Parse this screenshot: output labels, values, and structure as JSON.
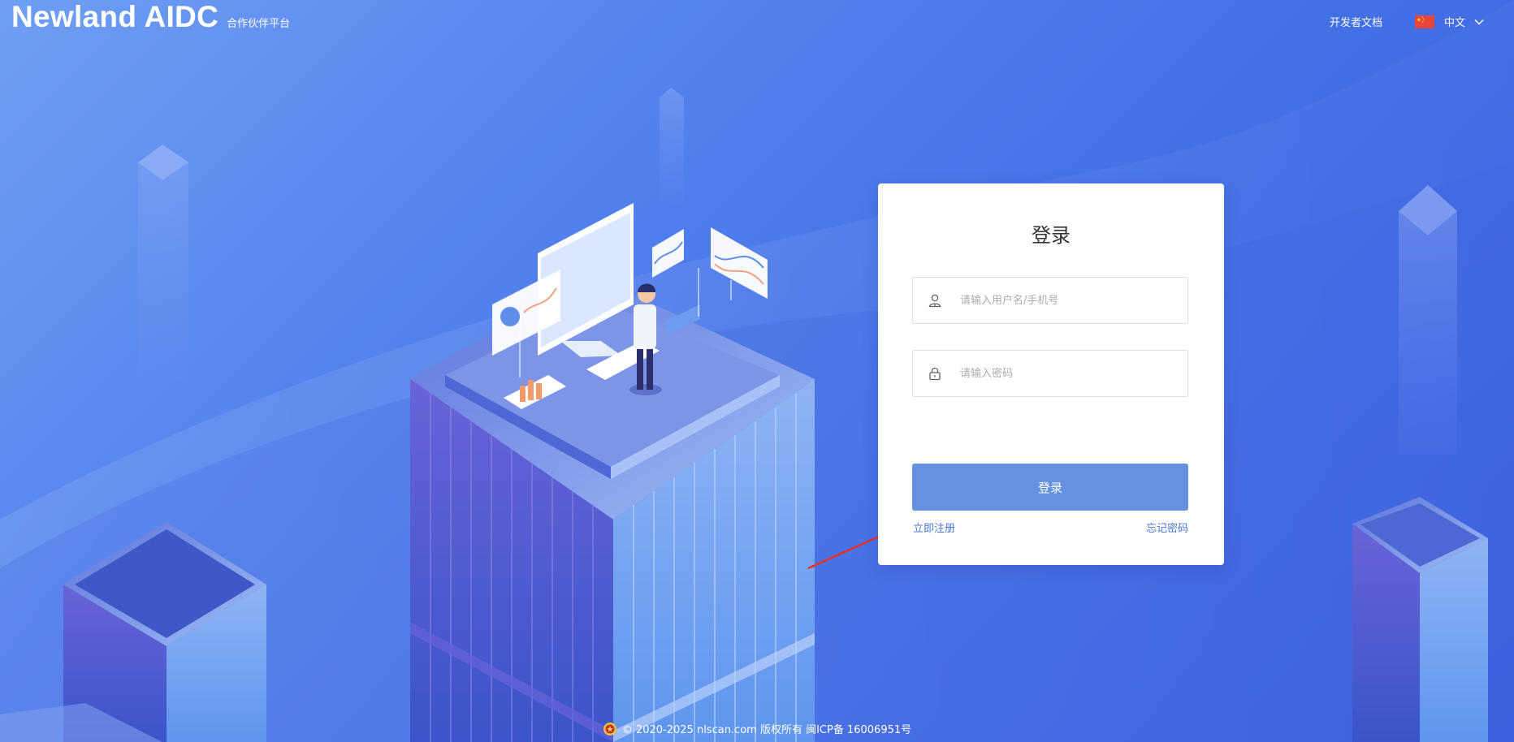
{
  "header": {
    "brand_name": "Newland AIDC",
    "brand_subtitle": "合作伙伴平台",
    "dev_docs_label": "开发者文档",
    "language": {
      "flag_icon": "china-flag-icon",
      "label": "中文",
      "chevron_icon": "chevron-down-icon"
    }
  },
  "login_card": {
    "title": "登录",
    "username_placeholder": "请输入用户名/手机号",
    "username_icon": "user-icon",
    "password_placeholder": "请输入密码",
    "password_icon": "lock-icon",
    "submit_label": "登录",
    "register_link": "立即注册",
    "forgot_link": "忘记密码"
  },
  "footer": {
    "icon": "police-badge-icon",
    "text": "© 2020-2025 nlscan.com 版权所有 闽ICP备 16006951号"
  },
  "colors": {
    "background_start": "#6f9ef4",
    "background_end": "#3a5ce0",
    "card_background": "#ffffff",
    "button": "#6690e0",
    "link": "#4a78d8",
    "annotation_arrow": "#e8312a"
  }
}
